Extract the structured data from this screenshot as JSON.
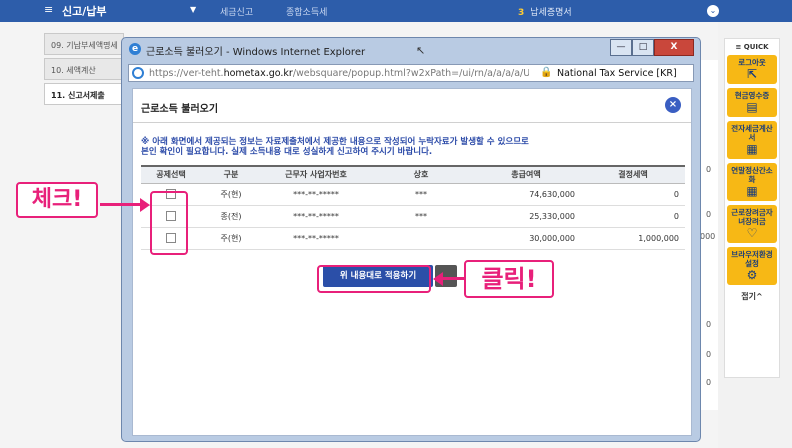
{
  "topnav": {
    "menu_icon": "≡",
    "title": "신고/납부",
    "caret": "▼",
    "item1": "세금신고",
    "item2": "종합소득세",
    "item3_num": "3",
    "item3": "납세증명서",
    "down_icon": "⌄"
  },
  "steps": [
    {
      "label": "09. 기납부세액명세"
    },
    {
      "label": "10. 세액계산"
    },
    {
      "label": "11. 신고서제출"
    }
  ],
  "bg": {
    "right_values": [
      "0",
      "0",
      "000",
      "0",
      "0",
      "0"
    ]
  },
  "quick": {
    "title": "≡ QUICK",
    "items": [
      {
        "label": "로그아웃",
        "icon": "⇱"
      },
      {
        "label": "현금영수증",
        "icon": "▤"
      },
      {
        "label": "전자세금계산서",
        "icon": "▦"
      },
      {
        "label": "연말정산간소화",
        "icon": "▦"
      },
      {
        "label": "근로장려금자녀장려금",
        "icon": "♡"
      },
      {
        "label": "브라우저환경설정",
        "icon": "⚙"
      }
    ],
    "collapse": "접기^"
  },
  "ie": {
    "title": "근로소득 불러오기 - Windows Internet Explorer",
    "url_prefix": "https://ver-teht.",
    "url_domain": "hometax.go.kr",
    "url_suffix": "/websquare/popup.html?w2xPath=/ui/rn/a/a/a/a/UI",
    "site_name": "National Tax Service [KR]",
    "btn_min": "—",
    "btn_max": "□",
    "btn_close": "X"
  },
  "popup": {
    "title": "근로소득 불러오기",
    "close": "×",
    "notice_line1": "※ 아래 화면에서 제공되는 정보는 자료제출처에서 제공한 내용으로 작성되어 누락자료가 발생할 수 있으므로",
    "notice_line2": "본인 확인이 필요합니다. 실제 소득내용 대로 성실하게 신고하여 주시기 바랍니다.",
    "columns": [
      "공제선택",
      "구분",
      "근무자 사업자번호",
      "상호",
      "총급여액",
      "결정세액"
    ],
    "rows": [
      {
        "type": "주(현)",
        "bizno": "***-**-*****",
        "name": "***",
        "salary": "74,630,000",
        "tax": "0"
      },
      {
        "type": "종(전)",
        "bizno": "***-**-*****",
        "name": "***",
        "salary": "25,330,000",
        "tax": "0"
      },
      {
        "type": "주(현)",
        "bizno": "***-**-*****",
        "name": "",
        "salary": "30,000,000",
        "tax": "1,000,000"
      }
    ],
    "apply_button": "위 내용대로 적용하기"
  },
  "annotations": {
    "check": "체크!",
    "click": "클릭!",
    "color": "#e8207a"
  }
}
